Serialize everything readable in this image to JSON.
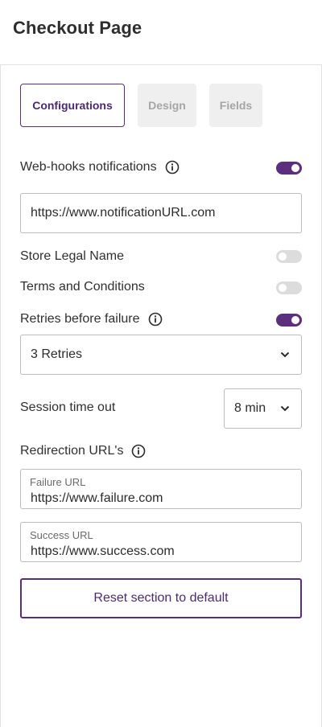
{
  "page": {
    "title": "Checkout Page"
  },
  "tabs": [
    {
      "label": "Configurations",
      "active": true
    },
    {
      "label": "Design",
      "active": false
    },
    {
      "label": "Fields",
      "active": false
    }
  ],
  "webhooks": {
    "label": "Web-hooks notifications",
    "enabled": true,
    "url": "https://www.notificationURL.com"
  },
  "store_legal_name": {
    "label": "Store Legal Name",
    "enabled": false
  },
  "terms": {
    "label": "Terms and Conditions",
    "enabled": false
  },
  "retries": {
    "label": "Retries before failure",
    "enabled": true,
    "selected": "3 Retries"
  },
  "session": {
    "label": "Session time out",
    "selected": "8 min"
  },
  "redirection": {
    "label": "Redirection URL's",
    "failure": {
      "label": "Failure URL",
      "value": "https://www.failure.com"
    },
    "success": {
      "label": "Success URL",
      "value": "https://www.success.com"
    }
  },
  "reset_button": {
    "label": "Reset section to default"
  },
  "colors": {
    "accent": "#5c2e7e",
    "toggle_off": "#dcdcdc",
    "tab_inactive_bg": "#efefef"
  }
}
